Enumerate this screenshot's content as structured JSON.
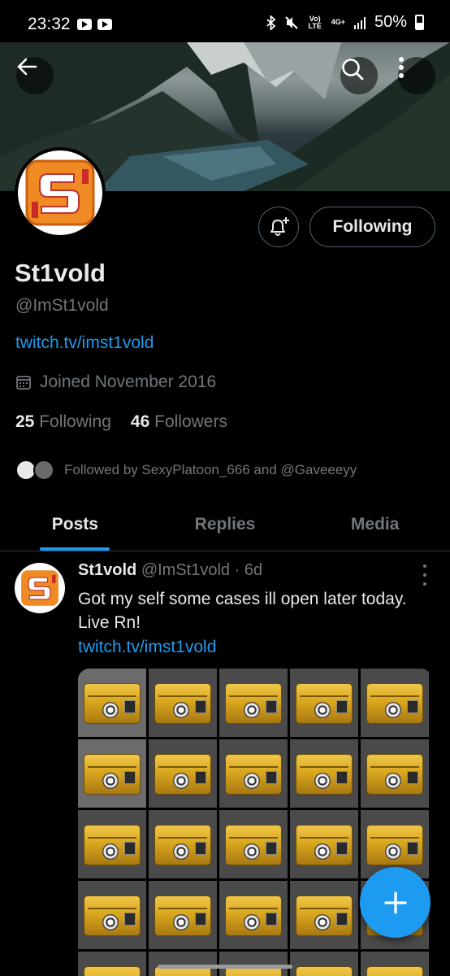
{
  "status_bar": {
    "time": "23:32",
    "network_volte": "Vo) LTE",
    "network_4g": "4G+",
    "battery": "50%"
  },
  "profile": {
    "name": "St1vold",
    "handle": "@ImSt1vold",
    "website": "twitch.tv/imst1vold",
    "joined": "Joined November 2016",
    "following_count": "25",
    "following_label": "Following",
    "followers_count": "46",
    "followers_label": "Followers",
    "followed_by": "Followed by SexyPlatoon_666 and @Gaveeeyy",
    "follow_button_label": "Following"
  },
  "tabs": [
    {
      "label": "Posts",
      "active": true
    },
    {
      "label": "Replies",
      "active": false
    },
    {
      "label": "Media",
      "active": false
    }
  ],
  "post": {
    "author_name": "St1vold",
    "author_handle": "@ImSt1vold",
    "time": "· 6d",
    "text": "Got my self some cases ill open later today. Live Rn!",
    "link": "twitch.tv/imst1vold"
  },
  "colors": {
    "accent": "#1d9bf0",
    "background": "#000000",
    "muted_text": "#71767b",
    "logo_orange": "#f08a24"
  },
  "icons": [
    "back-arrow-icon",
    "search-icon",
    "more-vertical-icon",
    "notification-bell-plus-icon",
    "calendar-icon",
    "plus-icon"
  ]
}
